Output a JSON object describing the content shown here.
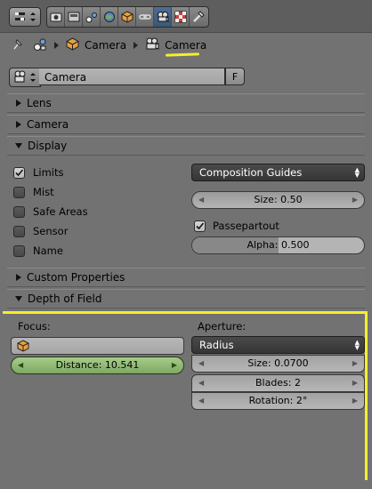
{
  "breadcrumb": {
    "item1": "Camera",
    "item2": "Camera"
  },
  "datablock": {
    "name": "Camera",
    "fake_user": "F"
  },
  "panels": {
    "lens": "Lens",
    "camera": "Camera",
    "display": "Display",
    "custom_properties": "Custom Properties",
    "depth_of_field": "Depth of Field"
  },
  "display": {
    "checks": [
      {
        "label": "Limits",
        "checked": true
      },
      {
        "label": "Mist",
        "checked": false
      },
      {
        "label": "Safe Areas",
        "checked": false
      },
      {
        "label": "Sensor",
        "checked": false
      },
      {
        "label": "Name",
        "checked": false
      }
    ],
    "composition_guides": "Composition Guides",
    "size": "Size: 0.50",
    "passepartout": {
      "label": "Passepartout",
      "checked": true
    },
    "alpha": {
      "label": "Alpha: 0.500",
      "value": 0.5
    }
  },
  "dof": {
    "focus_label": "Focus:",
    "distance": "Distance: 10.541",
    "aperture_label": "Aperture:",
    "aperture_type": "Radius",
    "size": "Size: 0.0700",
    "blades": "Blades: 2",
    "rotation": "Rotation: 2°"
  },
  "colors": {
    "annotation": "#f5ef2a",
    "background": "#727272",
    "active_tab": "#4b6e96",
    "distance_field": "#8fbb72"
  },
  "icons": {
    "context_tabs": [
      "render-icon",
      "render-layers-icon",
      "scene-icon",
      "world-icon",
      "object-icon",
      "constraints-icon",
      "camera-data-icon",
      "texture-icon",
      "physics-icon"
    ]
  }
}
